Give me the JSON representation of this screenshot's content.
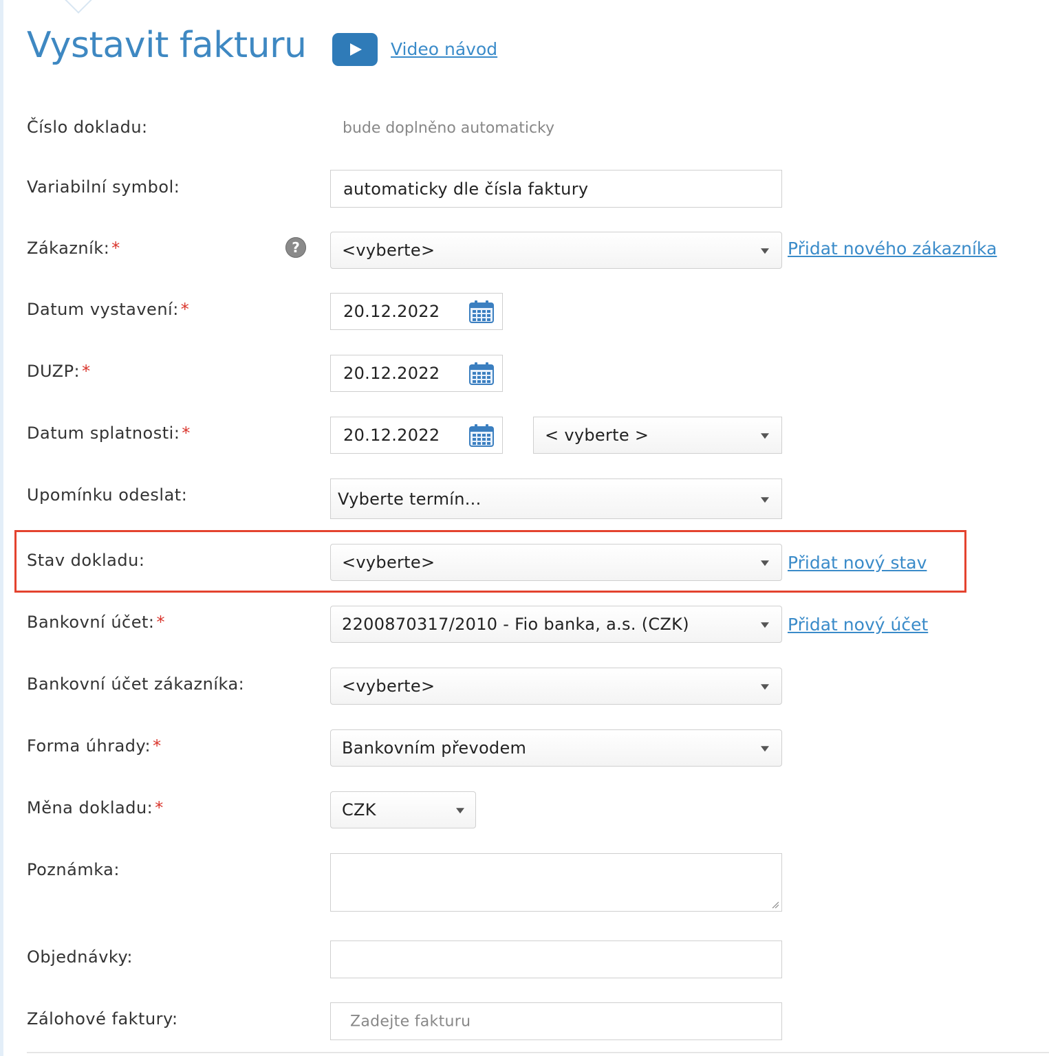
{
  "header": {
    "title": "Vystavit fakturu",
    "video_link": "Video návod"
  },
  "form": {
    "doc_number": {
      "label": "Číslo dokladu:",
      "value": "bude doplněno automaticky"
    },
    "variable_symbol": {
      "label": "Variabilní symbol:",
      "value": "automaticky dle čísla faktury"
    },
    "customer": {
      "label": "Zákazník:",
      "required": "*",
      "value": "<vyberte>",
      "link": "Přidat nového zákazníka",
      "help_icon": "question-circle-icon"
    },
    "issue_date": {
      "label": "Datum vystavení:",
      "required": "*",
      "value": "20.12.2022"
    },
    "duzp": {
      "label": "DUZP:",
      "required": "*",
      "value": "20.12.2022"
    },
    "due_date": {
      "label": "Datum splatnosti:",
      "required": "*",
      "value": "20.12.2022",
      "term_value": "< vyberte >"
    },
    "reminder": {
      "label": "Upomínku odeslat:",
      "value": "Vyberte termín..."
    },
    "status": {
      "label": "Stav dokladu:",
      "value": "<vyberte>",
      "link": "Přidat nový stav"
    },
    "bank_account": {
      "label": "Bankovní účet:",
      "required": "*",
      "value": "2200870317/2010 - Fio banka, a.s. (CZK)",
      "link": "Přidat nový účet"
    },
    "customer_bank_account": {
      "label": "Bankovní účet zákazníka:",
      "value": "<vyberte>"
    },
    "payment_method": {
      "label": "Forma úhrady:",
      "required": "*",
      "value": "Bankovním převodem"
    },
    "currency": {
      "label": "Měna dokladu:",
      "required": "*",
      "value": "CZK"
    },
    "note": {
      "label": "Poznámka:",
      "value": ""
    },
    "orders": {
      "label": "Objednávky:",
      "value": ""
    },
    "advance_invoices": {
      "label": "Zálohové faktury:",
      "placeholder": "Zadejte fakturu"
    }
  },
  "colors": {
    "accent": "#3e88c2",
    "link": "#3a8bc9",
    "required": "#d9342b",
    "highlight": "#e4432f",
    "video_button": "#2f7bb8"
  }
}
